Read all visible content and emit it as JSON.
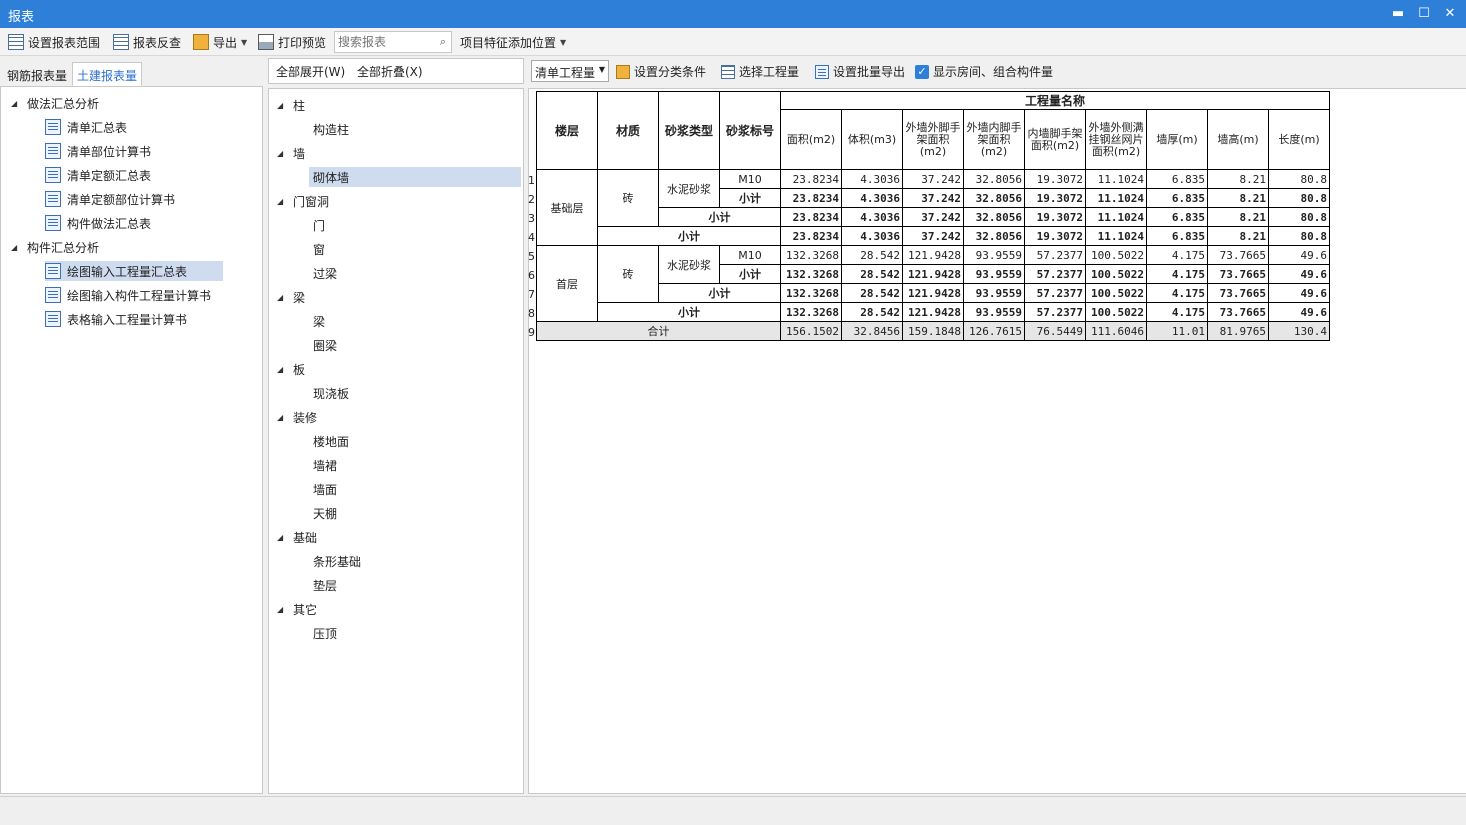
{
  "window": {
    "title": "报表",
    "minimize": "▬",
    "maximize": "☐",
    "close": "✕"
  },
  "toolbar": {
    "set_range": "设置报表范围",
    "report_check": "报表反查",
    "export": "导出",
    "print_preview": "打印预览",
    "search_placeholder": "搜索报表",
    "feature_position": "项目特征添加位置"
  },
  "tabs": {
    "steel": "钢筋报表量",
    "civil": "土建报表量"
  },
  "left_tree": [
    {
      "label": "做法汇总分析",
      "level": 0,
      "group": true
    },
    {
      "label": "清单汇总表",
      "level": 1
    },
    {
      "label": "清单部位计算书",
      "level": 1
    },
    {
      "label": "清单定额汇总表",
      "level": 1
    },
    {
      "label": "清单定额部位计算书",
      "level": 1
    },
    {
      "label": "构件做法汇总表",
      "level": 1
    },
    {
      "label": "构件汇总分析",
      "level": 0,
      "group": true
    },
    {
      "label": "绘图输入工程量汇总表",
      "level": 1,
      "selected": true
    },
    {
      "label": "绘图输入构件工程量计算书",
      "level": 1
    },
    {
      "label": "表格输入工程量计算书",
      "level": 1
    }
  ],
  "middle": {
    "expand_all": "全部展开(W)",
    "collapse_all": "全部折叠(X)",
    "tree": [
      {
        "label": "柱",
        "group": true
      },
      {
        "label": "构造柱"
      },
      {
        "label": "墙",
        "group": true
      },
      {
        "label": "砌体墙",
        "selected": true
      },
      {
        "label": "门窗洞",
        "group": true
      },
      {
        "label": "门"
      },
      {
        "label": "窗"
      },
      {
        "label": "过梁"
      },
      {
        "label": "梁",
        "group": true
      },
      {
        "label": "梁"
      },
      {
        "label": "圈梁"
      },
      {
        "label": "板",
        "group": true
      },
      {
        "label": "现浇板"
      },
      {
        "label": "装修",
        "group": true
      },
      {
        "label": "楼地面"
      },
      {
        "label": "墙裙"
      },
      {
        "label": "墙面"
      },
      {
        "label": "天棚"
      },
      {
        "label": "基础",
        "group": true
      },
      {
        "label": "条形基础"
      },
      {
        "label": "垫层"
      },
      {
        "label": "其它",
        "group": true
      },
      {
        "label": "压顶"
      }
    ]
  },
  "right_toolbar": {
    "combo": "清单工程量",
    "set_category": "设置分类条件",
    "select_quantity": "选择工程量",
    "batch_export": "设置批量导出",
    "show_rooms": "显示房间、组合构件量"
  },
  "report": {
    "group_header": "工程量名称",
    "headers": {
      "floor": "楼层",
      "material": "材质",
      "mortar_type": "砂浆类型",
      "mortar_grade": "砂浆标号",
      "cols": [
        "面积(m2)",
        "体积(m3)",
        "外墙外脚手架面积(m2)",
        "外墙内脚手架面积(m2)",
        "内墙脚手架面积(m2)",
        "外墙外侧满挂钢丝网片面积(m2)",
        "墙厚(m)",
        "墙高(m)",
        "长度(m)"
      ]
    },
    "floors": [
      {
        "name": "基础层",
        "material": "砖",
        "mortar": "水泥砂浆",
        "grade": "M10",
        "values": [
          "23.8234",
          "4.3036",
          "37.242",
          "32.8056",
          "19.3072",
          "11.1024",
          "6.835",
          "8.21",
          "80.8"
        ]
      },
      {
        "name": "首层",
        "material": "砖",
        "mortar": "水泥砂浆",
        "grade": "M10",
        "values": [
          "132.3268",
          "28.542",
          "121.9428",
          "93.9559",
          "57.2377",
          "100.5022",
          "4.175",
          "73.7665",
          "49.6"
        ]
      }
    ],
    "subtotal": "小计",
    "total_label": "合计",
    "total": [
      "156.1502",
      "32.8456",
      "159.1848",
      "126.7615",
      "76.5449",
      "111.6046",
      "11.01",
      "81.9765",
      "130.4"
    ],
    "row_numbers": [
      "1",
      "2",
      "3",
      "4",
      "5",
      "6",
      "7",
      "8",
      "9"
    ]
  }
}
